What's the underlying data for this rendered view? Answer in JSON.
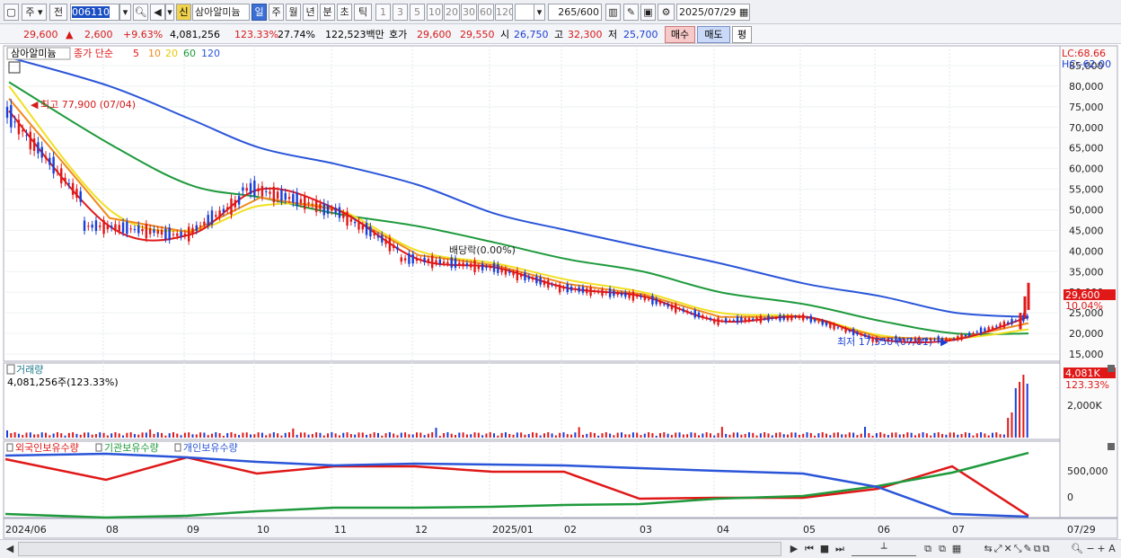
{
  "toolbar": {
    "type_label": "주",
    "prev_label": "전",
    "code": "006110",
    "new_badge": "신",
    "stock_name": "삼아알미늄",
    "period_tabs": [
      "일",
      "주",
      "월",
      "년",
      "분",
      "초",
      "틱"
    ],
    "interval_buttons": [
      "1",
      "3",
      "5",
      "10",
      "20",
      "30",
      "60",
      "120"
    ],
    "count_value": "265",
    "count_total": "/600",
    "date": "2025/07/29"
  },
  "info": {
    "price": "29,600",
    "change": "2,600",
    "change_pct": "+9.63%",
    "volume": "4,081,256",
    "vol_ratio": "123.33%",
    "turnover": "27.74%",
    "amount": "122,523백만",
    "quote_label": "호가",
    "ask": "29,600",
    "bid": "29,550",
    "open_label": "시",
    "open": "26,750",
    "high_label": "고",
    "high": "32,300",
    "low_label": "저",
    "low": "25,700",
    "buy_label": "매수",
    "sell_label": "매도",
    "eval_label": "평"
  },
  "price_panel": {
    "legend_name": "삼아알미늄",
    "ma_label": "종가 단순",
    "ma_periods": [
      "5",
      "10",
      "20",
      "60",
      "120"
    ],
    "lc": "LC:68.66",
    "hc": "HC:-62.00",
    "high_annotation": "최고 77,900 (07/04)",
    "low_annotation": "최저 17,550 (07/01)",
    "dividend_annotation": "배당락(0.00%)",
    "current_price_tag": "29,600",
    "current_pct_tag": "10.04%",
    "y_ticks": [
      "85,000",
      "80,000",
      "75,000",
      "70,000",
      "65,000",
      "60,000",
      "55,000",
      "50,000",
      "45,000",
      "40,000",
      "35,000",
      "30,000",
      "25,000",
      "20,000",
      "15,000"
    ]
  },
  "volume_panel": {
    "title": "거래량",
    "value_label": "4,081,256주(123.33%)",
    "tag_value": "4,081K",
    "tag_pct": "123.33%",
    "y_tick": "2,000K"
  },
  "holding_panel": {
    "legends": [
      "외국인보유수량",
      "기관보유수량",
      "개인보유수량"
    ],
    "y_ticks": [
      "500,000",
      "0"
    ]
  },
  "x_axis": {
    "labels": [
      "2024/06",
      "08",
      "09",
      "10",
      "11",
      "12",
      "2025/01",
      "02",
      "03",
      "04",
      "05",
      "06",
      "07"
    ],
    "last_label": "07/29"
  },
  "colors": {
    "ma5": "#e01818",
    "ma10": "#f08a1c",
    "ma20": "#f0e020",
    "ma60": "#1e9a3c",
    "ma120": "#2a55d8",
    "up": "#e01818",
    "down": "#1a3fd6"
  },
  "chart_data": {
    "type": "line",
    "x": [
      "2024/06",
      "08",
      "09",
      "10",
      "11",
      "12",
      "2025/01",
      "02",
      "03",
      "04",
      "05",
      "06",
      "07",
      "07/29"
    ],
    "series": [
      {
        "name": "5",
        "values": [
          74000,
          46000,
          44000,
          55000,
          50000,
          38000,
          36000,
          31000,
          29000,
          23000,
          24000,
          18500,
          18500,
          24000
        ]
      },
      {
        "name": "20",
        "values": [
          80000,
          50000,
          45000,
          51000,
          50000,
          40000,
          37000,
          33000,
          30000,
          25000,
          24000,
          19500,
          18800,
          21000
        ]
      },
      {
        "name": "60",
        "values": [
          81000,
          66000,
          56000,
          53000,
          49000,
          46000,
          42000,
          38000,
          35000,
          30000,
          27000,
          23000,
          20000,
          20000
        ]
      },
      {
        "name": "120",
        "values": [
          87000,
          80000,
          72000,
          65000,
          61000,
          56000,
          49000,
          45000,
          41000,
          37000,
          32000,
          29000,
          25000,
          24000
        ]
      }
    ],
    "xlabel": "",
    "ylabel": "",
    "ylim": [
      15000,
      85000
    ]
  }
}
